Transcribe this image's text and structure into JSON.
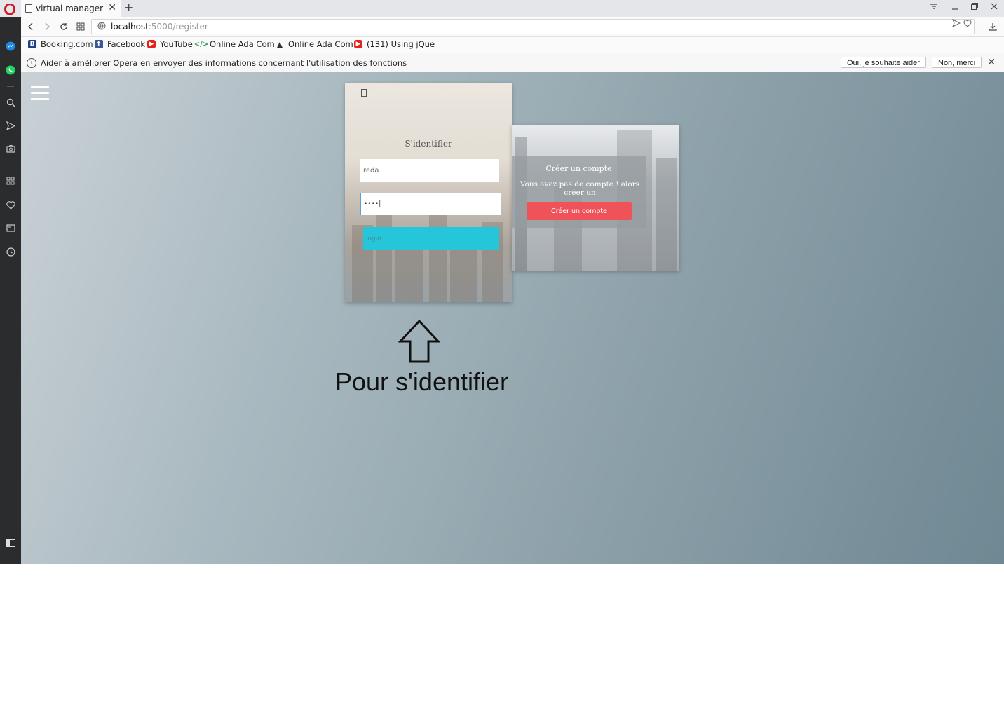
{
  "browser": {
    "tab_title": "virtual manager",
    "new_tab": "+",
    "tab_close": "✕",
    "url_host": "localhost",
    "url_path": ":5000/register"
  },
  "bookmarks": [
    {
      "label": "Booking.com",
      "icon": "booking-icon",
      "color": "#1e3f8a"
    },
    {
      "label": "Facebook",
      "icon": "facebook-icon",
      "color": "#3b5998"
    },
    {
      "label": "YouTube",
      "icon": "youtube-icon",
      "color": "#e62117"
    },
    {
      "label": "Online Ada Com",
      "icon": "code-icon",
      "color": "#2e9b4d"
    },
    {
      "label": "Online Ada Com",
      "icon": "ada-icon",
      "color": "#333333"
    },
    {
      "label": "(131) Using jQue",
      "icon": "youtube-icon",
      "color": "#e62117"
    }
  ],
  "infobar": {
    "message": "Aider à améliorer Opera en envoyer des informations concernant l'utilisation des fonctions",
    "accept": "Oui, je souhaite aider",
    "decline": "Non, merci",
    "close": "✕"
  },
  "login": {
    "title": "S'identifier",
    "username_value": "reda",
    "password_value": "••••|",
    "button": "login"
  },
  "register": {
    "title": "Créer un compte",
    "text": "Vous avez pas de compte ! alors créer un",
    "button": "Créer un compte"
  },
  "annotation": {
    "text": "Pour s'identifier"
  },
  "colors": {
    "login_button": "#26c6da",
    "register_button": "#f0525a",
    "opera_red": "#cc1b22"
  }
}
